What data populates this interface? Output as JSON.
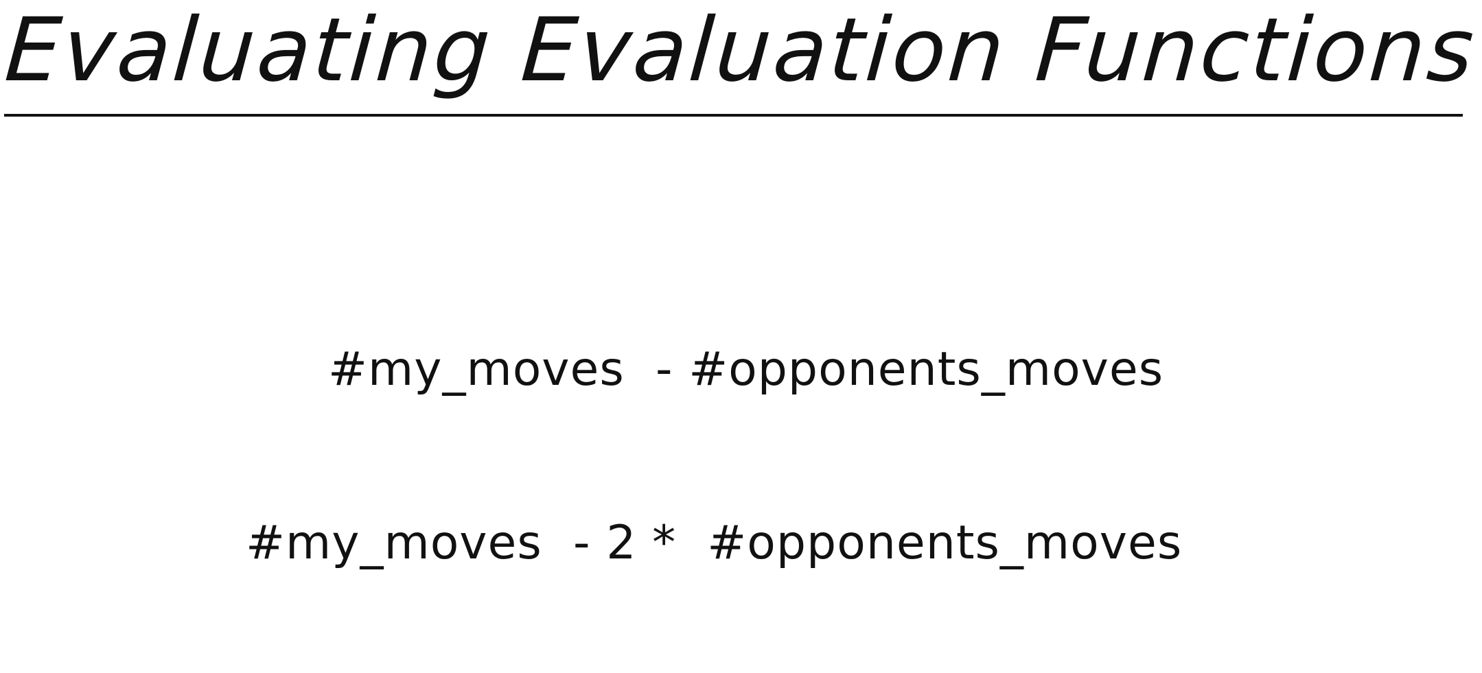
{
  "slide": {
    "title": "Evaluating Evaluation Functions",
    "formulas": [
      "#my_moves  - #opponents_moves",
      "#my_moves  - 2 *  #opponents_moves"
    ]
  },
  "colors": {
    "ink": "#111111",
    "background": "#ffffff"
  }
}
